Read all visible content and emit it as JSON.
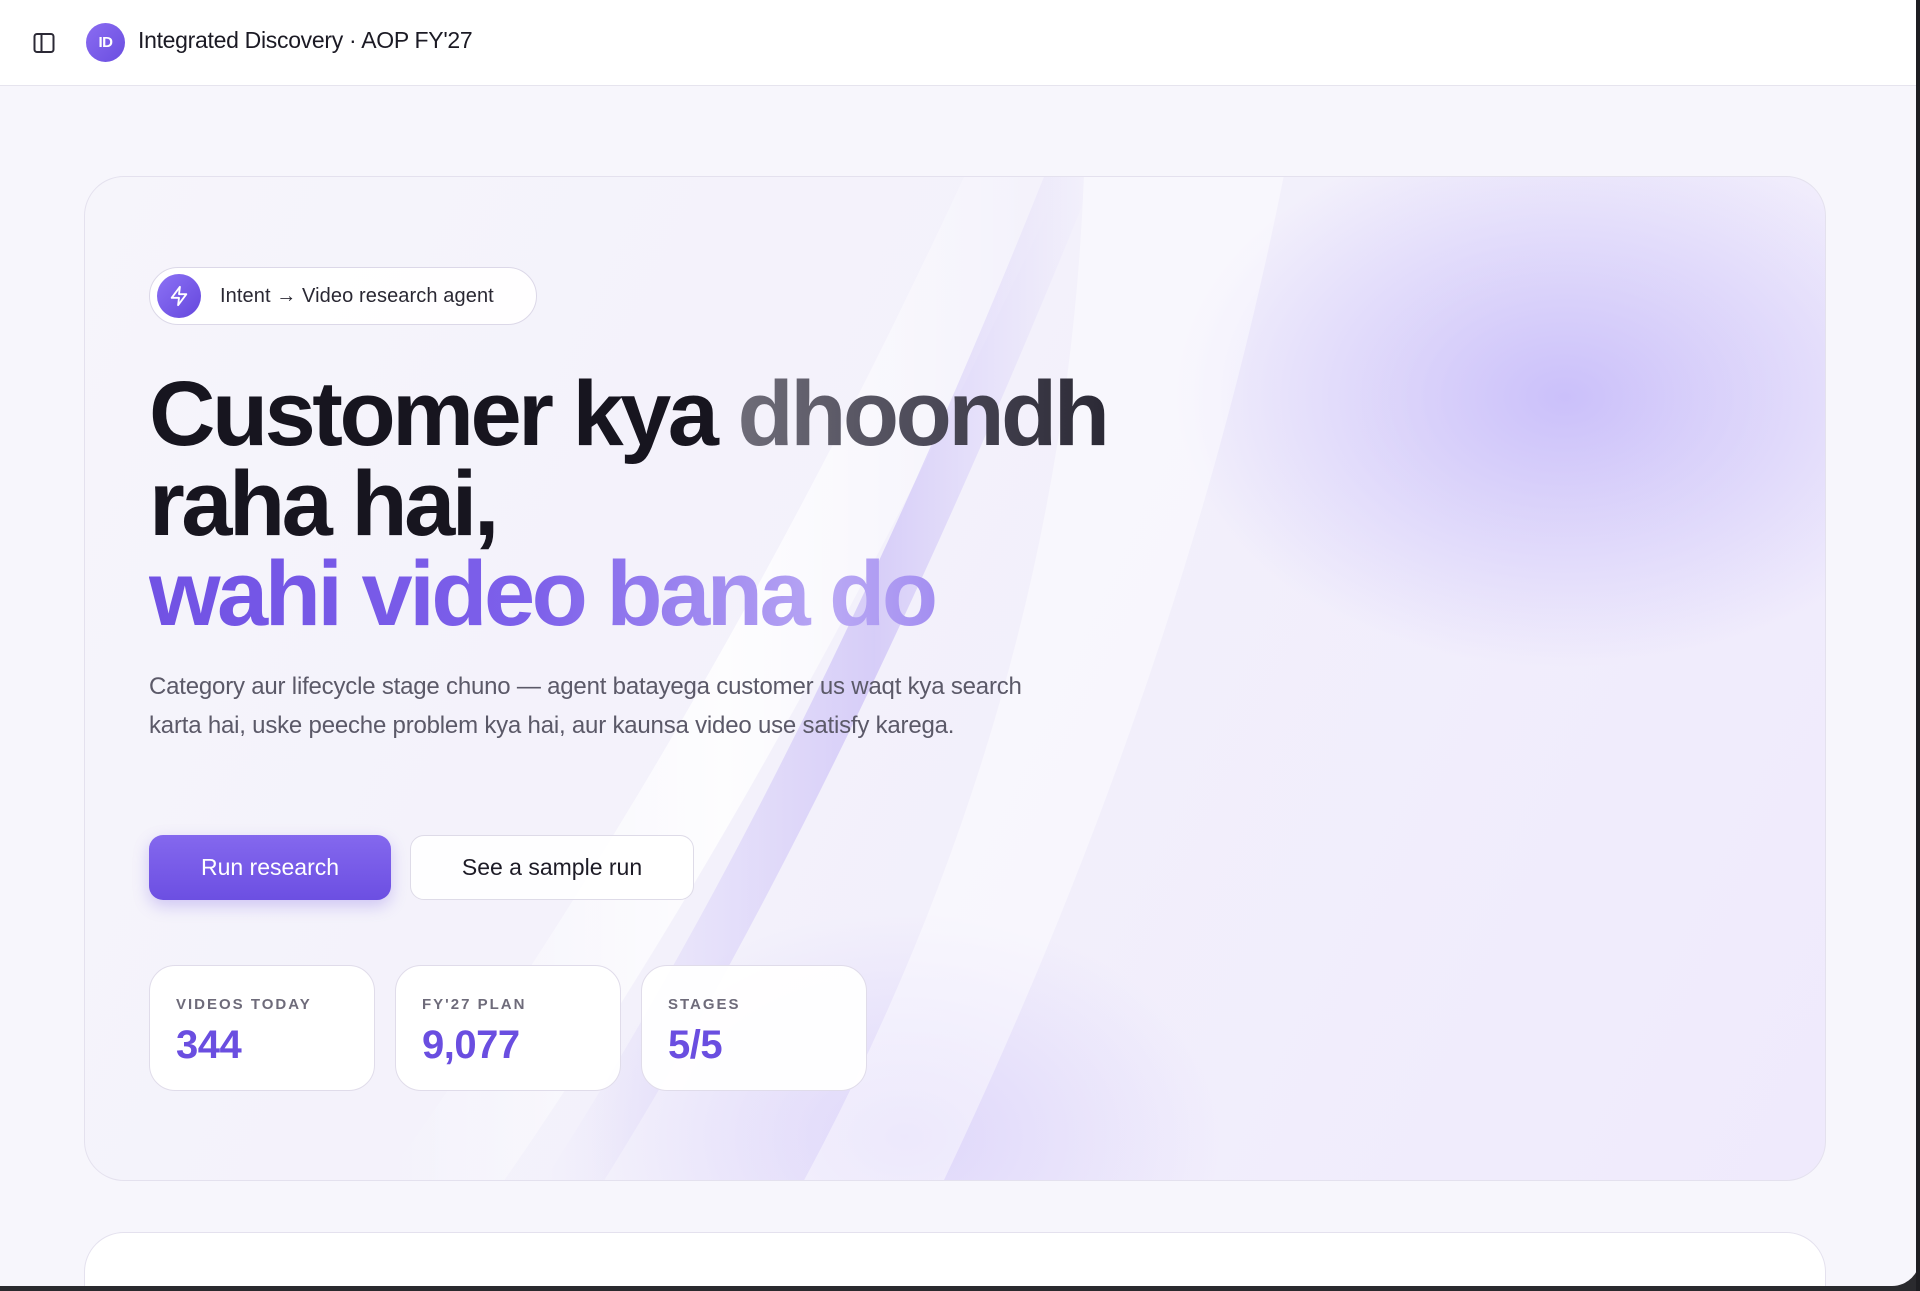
{
  "header": {
    "avatar_initials": "ID",
    "title": "Integrated Discovery · AOP FY'27",
    "sidebar_toggle_icon": "sidebar-panel-icon"
  },
  "hero": {
    "badge": {
      "icon": "lightning-icon",
      "text": "Intent → Video research agent"
    },
    "headline": {
      "line1_a": "Customer kya ",
      "line1_b": "dhoondh",
      "line2": "raha hai,",
      "line3": "wahi video bana do"
    },
    "subtext": "Category aur lifecycle stage chuno — agent batayega customer us waqt kya search karta hai, uske peeche problem kya hai, aur kaunsa video use satisfy karega.",
    "buttons": {
      "primary": "Run research",
      "secondary": "See a sample run"
    },
    "stats": [
      {
        "label": "VIDEOS TODAY",
        "value": "344"
      },
      {
        "label": "FY'27 PLAN",
        "value": "9,077"
      },
      {
        "label": "STAGES",
        "value": "5/5"
      }
    ]
  },
  "colors": {
    "accent": "#6c4fe2",
    "accent_light": "#b9a8f4",
    "text_dark": "#17151f",
    "text_muted": "#5b5968",
    "background": "#f7f6fc"
  }
}
